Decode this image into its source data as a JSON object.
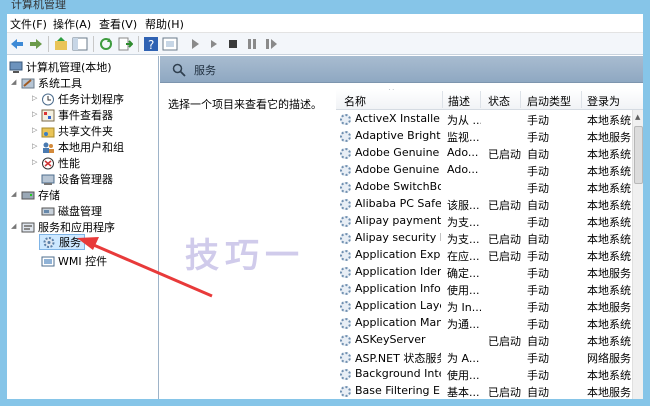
{
  "window": {
    "title": "计算机管理"
  },
  "menu": [
    "文件(F)",
    "操作(A)",
    "查看(V)",
    "帮助(H)"
  ],
  "tree": {
    "root": "计算机管理(本地)",
    "system_tools": "系统工具",
    "task_scheduler": "任务计划程序",
    "event_viewer": "事件查看器",
    "shared_folders": "共享文件夹",
    "local_users": "本地用户和组",
    "performance": "性能",
    "device_manager": "设备管理器",
    "storage": "存储",
    "disk_management": "磁盘管理",
    "services_apps": "服务和应用程序",
    "services": "服务",
    "wmi": "WMI 控件"
  },
  "pane": {
    "title": "服务",
    "description": "选择一个项目来查看它的描述。"
  },
  "columns": {
    "name": "名称",
    "desc": "描述",
    "status": "状态",
    "startup": "启动类型",
    "logon": "登录为"
  },
  "services": [
    {
      "name": "ActiveX Installer ...",
      "desc": "为从 ...",
      "status": "",
      "startup": "手动",
      "logon": "本地系统"
    },
    {
      "name": "Adaptive Brightn...",
      "desc": "监视...",
      "status": "",
      "startup": "手动",
      "logon": "本地服务"
    },
    {
      "name": "Adobe Genuine ...",
      "desc": "Ado...",
      "status": "已启动",
      "startup": "自动",
      "logon": "本地系统"
    },
    {
      "name": "Adobe Genuine ...",
      "desc": "Ado...",
      "status": "",
      "startup": "手动",
      "logon": "本地系统"
    },
    {
      "name": "Adobe SwitchBo...",
      "desc": "",
      "status": "",
      "startup": "手动",
      "logon": "本地系统"
    },
    {
      "name": "Alibaba PC Safe ...",
      "desc": "该服...",
      "status": "已启动",
      "startup": "自动",
      "logon": "本地系统"
    },
    {
      "name": "Alipay payment ...",
      "desc": "为支...",
      "status": "",
      "startup": "手动",
      "logon": "本地系统"
    },
    {
      "name": "Alipay security b...",
      "desc": "为支...",
      "status": "已启动",
      "startup": "自动",
      "logon": "本地系统"
    },
    {
      "name": "Application Expe...",
      "desc": "在应...",
      "status": "已启动",
      "startup": "手动",
      "logon": "本地系统"
    },
    {
      "name": "Application Iden...",
      "desc": "确定...",
      "status": "",
      "startup": "手动",
      "logon": "本地服务"
    },
    {
      "name": "Application Infor...",
      "desc": "使用...",
      "status": "",
      "startup": "手动",
      "logon": "本地系统"
    },
    {
      "name": "Application Laye...",
      "desc": "为 In...",
      "status": "",
      "startup": "手动",
      "logon": "本地服务"
    },
    {
      "name": "Application Man...",
      "desc": "为通...",
      "status": "",
      "startup": "手动",
      "logon": "本地系统"
    },
    {
      "name": "ASKeyServer",
      "desc": "",
      "status": "已启动",
      "startup": "自动",
      "logon": "本地系统"
    },
    {
      "name": "ASP.NET 状态服务",
      "desc": "为 A...",
      "status": "",
      "startup": "手动",
      "logon": "网络服务"
    },
    {
      "name": "Background Inte...",
      "desc": "使用...",
      "status": "",
      "startup": "手动",
      "logon": "本地系统"
    },
    {
      "name": "Base Filtering En...",
      "desc": "基本...",
      "status": "已启动",
      "startup": "自动",
      "logon": "本地服务"
    }
  ],
  "watermark": "技巧一",
  "colors": {
    "frame": "#86c5e8",
    "header": "#9bb3cb",
    "arrow": "#e83a3a",
    "selected": "#cde8ff"
  }
}
